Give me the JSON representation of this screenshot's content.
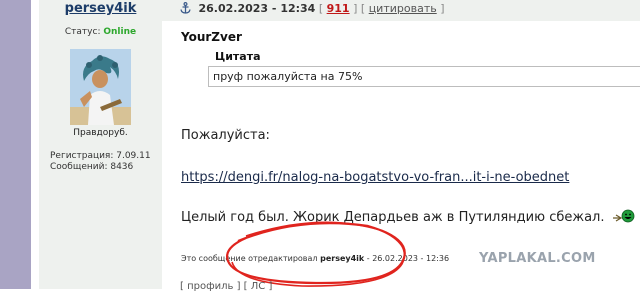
{
  "post": {
    "author": "persey4ik",
    "status_label": "Статус:",
    "status_value": "Online",
    "user_title": "Правдоруб.",
    "registration": "Регистрация: 7.09.11",
    "messages": "Сообщений: 8436",
    "date": "26.02.2023 - 12:34",
    "bracket_open": "[",
    "bracket_close": "]",
    "post_number": "911",
    "quote_action": "цитировать"
  },
  "content": {
    "quoted_author": "YourZver",
    "quote_title": "Цитата",
    "quote_text": "пруф пожалуйста на 75%",
    "line1": "Пожалуйста:",
    "link": "https://dengi.fr/nalog-na-bogatstvo-vo-fran...it-i-ne-obednet",
    "line3": "Целый год был. Жорик Депардьев аж в Путиляндию сбежал.",
    "smiley_icon": "laughing-smiley-icon",
    "edit_prefix": "Это сообщение отредактировал",
    "edit_user": "persey4ik",
    "edit_date": "- 26.02.2023 - 12:36"
  },
  "watermark": "YAPLAKAL.COM",
  "bottom_partial": "[ профиль ] [ ЛС ]",
  "colors": {
    "rail": "#a9a4c4",
    "author_bg": "#eef1ee",
    "username": "#1c3c68",
    "online": "#2ea82e",
    "post_number": "#c01818",
    "annotation": "#e0241e",
    "watermark": "#9aa3ad"
  }
}
